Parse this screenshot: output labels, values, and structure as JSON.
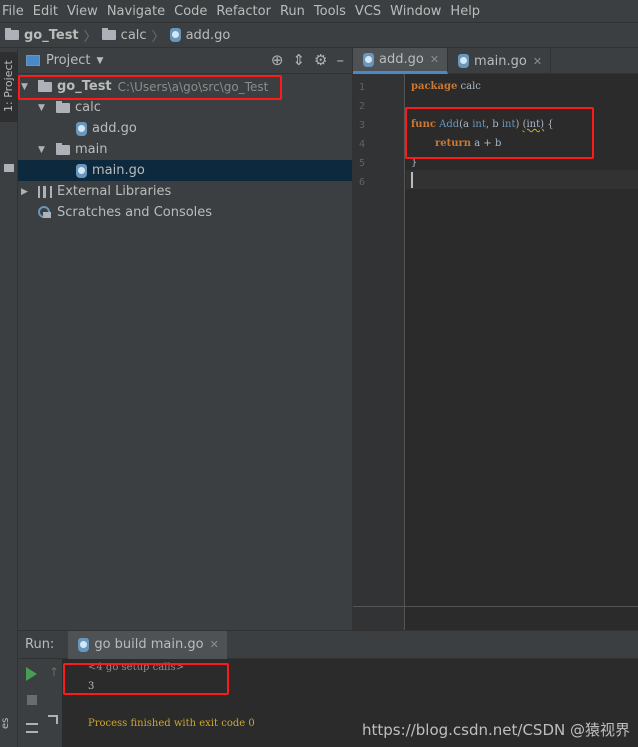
{
  "menubar": {
    "items": [
      "File",
      "Edit",
      "View",
      "Navigate",
      "Code",
      "Refactor",
      "Run",
      "Tools",
      "VCS",
      "Window",
      "Help"
    ]
  },
  "breadcrumb": {
    "items": [
      "go_Test",
      "calc",
      "add.go"
    ]
  },
  "left_strip": {
    "tab_label": "1: Project"
  },
  "project_panel": {
    "title": "Project",
    "tree": [
      {
        "label": "go_Test",
        "path": "C:\\Users\\a\\go\\src\\go_Test",
        "type": "root"
      },
      {
        "label": "calc",
        "type": "folder"
      },
      {
        "label": "add.go",
        "type": "gofile"
      },
      {
        "label": "main",
        "type": "folder"
      },
      {
        "label": "main.go",
        "type": "gofile",
        "selected": true
      },
      {
        "label": "External Libraries",
        "type": "libs"
      },
      {
        "label": "Scratches and Consoles",
        "type": "scratches"
      }
    ]
  },
  "editor": {
    "tabs": [
      {
        "label": "add.go",
        "active": true
      },
      {
        "label": "main.go",
        "active": false
      }
    ],
    "line_numbers": [
      "1",
      "2",
      "3",
      "4",
      "5",
      "6"
    ],
    "code": {
      "l1_kw": "package",
      "l1_rest": " calc",
      "l3_kw": "func",
      "l3_fn": "Add",
      "l3_open": "(a ",
      "l3_t1": "int",
      "l3_mid": ", b ",
      "l3_t2": "int",
      "l3_close": ") ",
      "l3_ret": "(int)",
      "l3_brace": " {",
      "l4_kw": "return",
      "l4_rest": " a + b",
      "l5": "}"
    }
  },
  "run_panel": {
    "label": "Run:",
    "tab_label": "go build main.go",
    "console": {
      "line1": "<4 go setup calls>",
      "line2": "3",
      "line3": "Process finished with exit code 0"
    },
    "watermark": "https://blog.csdn.net/CSDN @猿视界",
    "side_text": "es"
  },
  "colors": {
    "keyword": "#cc7832",
    "function": "#6897bb",
    "highlight_box": "#ff1a1a",
    "exit_text": "#cca633"
  }
}
